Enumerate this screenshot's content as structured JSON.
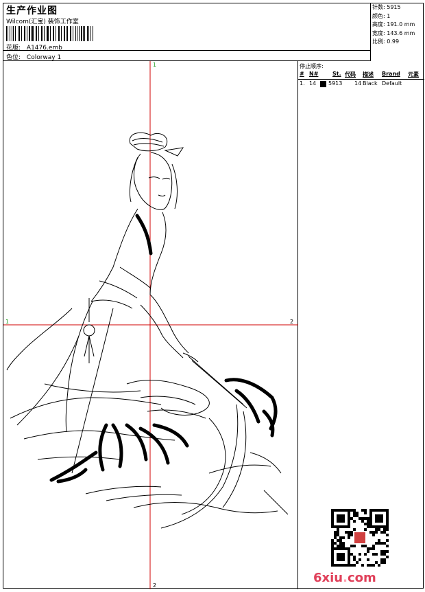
{
  "header": {
    "title": "生产作业图",
    "company": "Wilcom(汇宝) 装饰工作室",
    "design_label": "花版:",
    "design_value": "A1476.emb",
    "colorway_label": "色位:",
    "colorway_value": "Colorway 1"
  },
  "stats": [
    {
      "label": "针数:",
      "value": "5915"
    },
    {
      "label": "颜色:",
      "value": "1"
    },
    {
      "label": "高度:",
      "value": "191.0 mm"
    },
    {
      "label": "宽度:",
      "value": "143.6 mm"
    },
    {
      "label": "比例:",
      "value": "0.99"
    }
  ],
  "stop_sequence": {
    "title": "停止顺序:",
    "columns": [
      "#",
      "N#",
      "St.",
      "代码",
      "描述",
      "Brand",
      "元素"
    ],
    "rows": [
      {
        "index": "1.",
        "needle": "14",
        "stitches": "5913",
        "code": "14",
        "description": "Black",
        "brand": "Default",
        "swatch_color": "#000000"
      }
    ]
  },
  "crosshair": {
    "top": "1",
    "bottom": "2",
    "left": "1",
    "right": "2",
    "color": "#d00000",
    "label_color": "#1a9a1a"
  },
  "watermark": {
    "text_main": "6xiu",
    "text_dot": ".",
    "text_end": "com"
  }
}
